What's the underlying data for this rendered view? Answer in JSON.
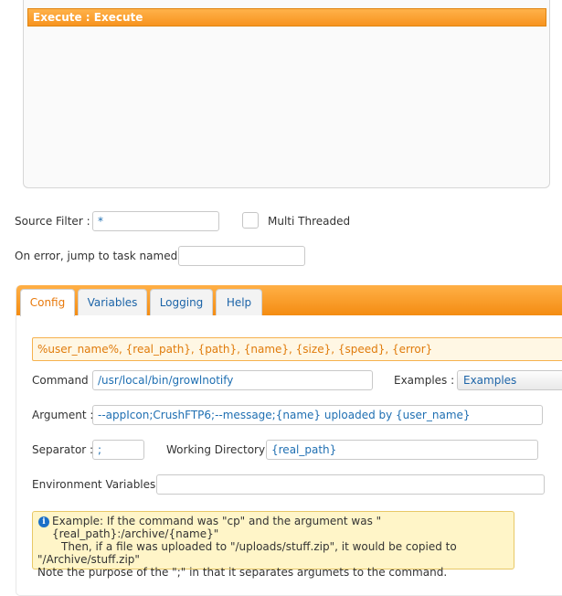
{
  "task_list": {
    "items": [
      {
        "label": "Execute : Execute",
        "selected": true
      }
    ]
  },
  "source_filter": {
    "label": "Source Filter :",
    "value": "*"
  },
  "multi_threaded": {
    "label": "Multi Threaded",
    "checked": false
  },
  "on_error": {
    "label": "On error, jump to task named :",
    "value": ""
  },
  "tabs": [
    {
      "label": "Config",
      "active": true
    },
    {
      "label": "Variables",
      "active": false
    },
    {
      "label": "Logging",
      "active": false
    },
    {
      "label": "Help",
      "active": false
    }
  ],
  "variables_hint": "%user_name%, {real_path}, {path}, {name}, {size}, {speed}, {error}",
  "command": {
    "label": "Command :",
    "value": "/usr/local/bin/growlnotify"
  },
  "examples": {
    "label": "Examples :",
    "selected": "Examples"
  },
  "argument": {
    "label": "Argument :",
    "value": "--appIcon;CrushFTP6;--message;{name} uploaded by {user_name}"
  },
  "separator": {
    "label": "Separator :",
    "value": ";"
  },
  "working_directory": {
    "label": "Working Directory :",
    "value": "{real_path}"
  },
  "environment_variables": {
    "label": "Environment Variables :",
    "value": ""
  },
  "help": {
    "line1": "Example: If the command was \"cp\" and the argument was \"{real_path}:/archive/{name}\"",
    "line2": "Then, if a file was uploaded to \"/uploads/stuff.zip\", it would be copied to",
    "line3": "\"/Archive/stuff.zip\"",
    "line4": "Note the purpose of the \";\" in that it separates argumets to the command."
  },
  "colors": {
    "accent": "#f7931e",
    "link_blue": "#1c64a8",
    "help_bg": "#fff5c8",
    "info_icon": "#1b6fc7"
  },
  "icons": {
    "info": "info-icon"
  }
}
